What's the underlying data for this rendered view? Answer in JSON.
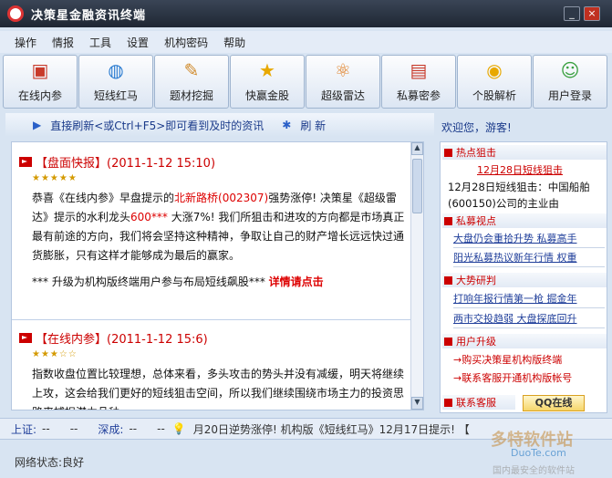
{
  "window": {
    "title": "决策星金融资讯终端"
  },
  "menu": [
    "操作",
    "情报",
    "工具",
    "设置",
    "机构密码",
    "帮助"
  ],
  "toolbar": [
    {
      "label": "在线内参",
      "icon": "tv-icon",
      "glyph": "▣",
      "color": "#c83a2a"
    },
    {
      "label": "短线红马",
      "icon": "globe-icon",
      "glyph": "◍",
      "color": "#2a7bd0"
    },
    {
      "label": "题材挖掘",
      "icon": "palette-icon",
      "glyph": "✎",
      "color": "#d08a2a"
    },
    {
      "label": "快赢金股",
      "icon": "star-icon",
      "glyph": "★",
      "color": "#e8a800"
    },
    {
      "label": "超级雷达",
      "icon": "radar-icon",
      "glyph": "⚛",
      "color": "#e07a1a"
    },
    {
      "label": "私募密参",
      "icon": "chat-icon",
      "glyph": "▤",
      "color": "#c83a2a"
    },
    {
      "label": "个股解析",
      "icon": "analysis-icon",
      "glyph": "◉",
      "color": "#e8a800"
    },
    {
      "label": "用户登录",
      "icon": "user-icon",
      "glyph": "☺",
      "color": "#3aa040"
    }
  ],
  "refresh": {
    "hint": "直接刷新<或Ctrl+F5>即可看到及时的资讯",
    "label": "刷 新"
  },
  "welcome": "欢迎您，游客!",
  "feed": [
    {
      "title": "【盘面快报】(2011-1-12 15:10)",
      "stars": "★★★★★",
      "text_a": "恭喜《在线内参》早盘提示的",
      "stock": "北新路桥(002307)",
      "text_b": "强势涨停! 决策星《超级雷达》提示的水利龙头",
      "gain": "600***",
      "text_c": " 大涨7%! 我们所狙击和进攻的方向都是市场真正最有前途的方向，我们将会坚持这种精神，争取让自己的财产增长远远快过通货膨胀，只有这样才能够成为最后的赢家。",
      "footer_a": "*** 升级为机构版终端用户参与布局短线飙股***",
      "footer_link": "详情请点击"
    },
    {
      "title": "【在线内参】(2011-1-12 15:6)",
      "stars": "★★★☆☆",
      "text": "指数收盘位置比较理想，总体来看，多头攻击的势头并没有减缓，明天将继续上攻，这会给我们更好的短线狙击空间，所以我们继续围绕市场主力的投资思路来捕捉潜力品种。"
    }
  ],
  "sidebar": {
    "hot_title": "热点狙击",
    "hot_link": "12月28日短线狙击",
    "hot_text": "12月28日短线狙击：中国船舶(600150)公司的主业由",
    "private_title": "私募视点",
    "private_items": [
      "大盘仍会重拾升势 私募高手",
      "阳光私募热议新年行情 权重"
    ],
    "trend_title": "大势研判",
    "trend_items": [
      "打响年报行情第一枪 掘金年",
      "两市交投趋弱 大盘探底回升"
    ],
    "upgrade_title": "用户升级",
    "upgrade_items": [
      "→购买决策星机构版终端",
      "→联系客服开通机构版帐号"
    ],
    "contact_title": "联系客服",
    "qq_label": "QQ在线"
  },
  "ticker": {
    "sh_label": "上证:",
    "sh_value": "--",
    "sh_change": "--",
    "sz_label": "深成:",
    "sz_value": "--",
    "sz_change": "--",
    "message": "月20日逆势涨停! 机构版《短线红马》12月17日提示! 【"
  },
  "status": "网络状态:良好",
  "watermark": {
    "brand": "多特软件站",
    "site": "DuoTe.com",
    "tagline": "国内最安全的软件站"
  }
}
